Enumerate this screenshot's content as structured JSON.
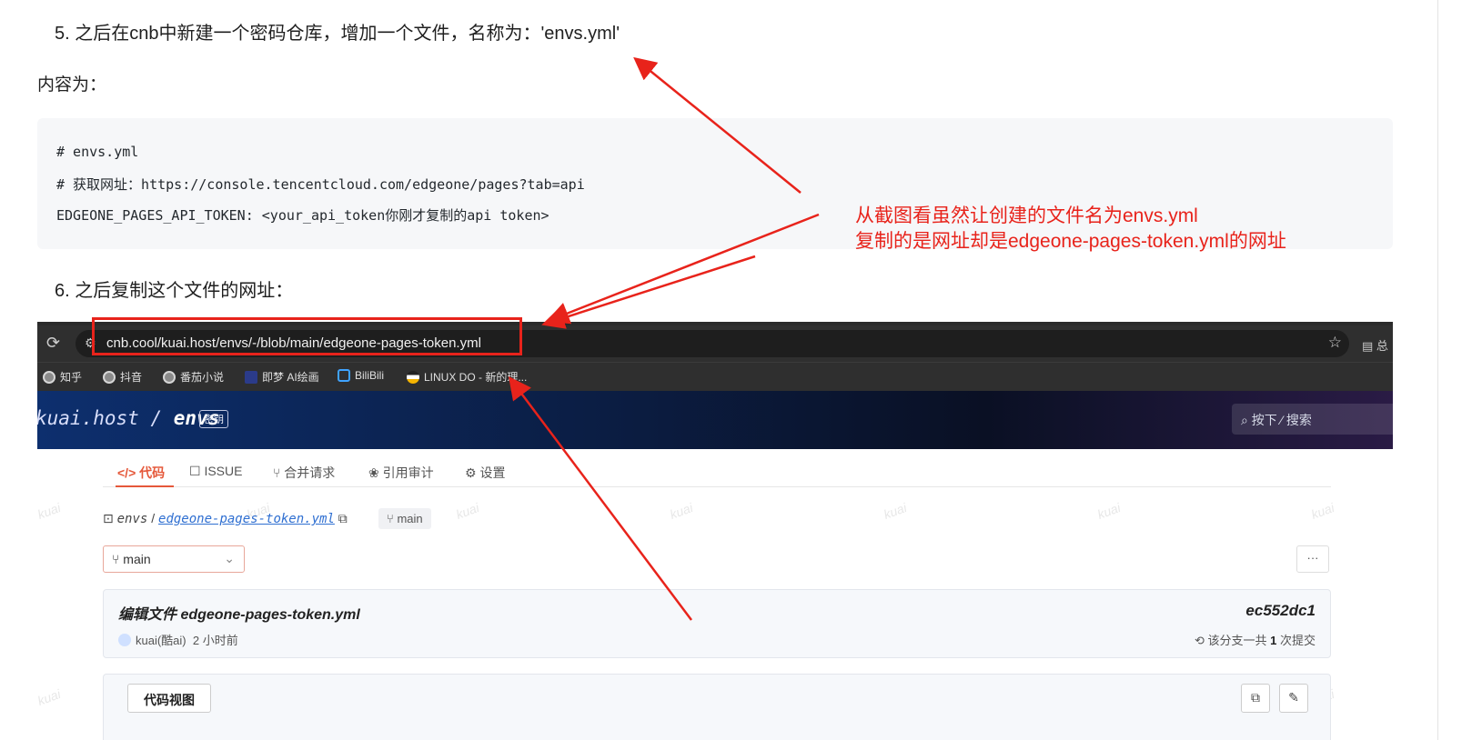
{
  "article": {
    "step5": "5. 之后在cnb中新建一个密码仓库，增加一个文件，名称为：'envs.yml'",
    "content_label": "内容为：",
    "code_lines": [
      "# envs.yml",
      "# 获取网址：https://console.tencentcloud.com/edgeone/pages?tab=api",
      "EDGEONE_PAGES_API_TOKEN: <your_api_token你刚才复制的api token>"
    ],
    "step6": "6. 之后复制这个文件的网址："
  },
  "annotation": {
    "line1": "从截图看虽然让创建的文件名为envs.yml",
    "line2": "复制的是网址却是edgeone-pages-token.yml的网址",
    "color": "#e8231b"
  },
  "browser": {
    "url": "cnb.cool/kuai.host/envs/-/blob/main/edgeone-pages-token.yml",
    "right_fragment": "总",
    "bookmarks": [
      {
        "label": "知乎",
        "icon": "globe-icon"
      },
      {
        "label": "抖音",
        "icon": "globe-icon"
      },
      {
        "label": "番茄小说",
        "icon": "globe-icon"
      },
      {
        "label": "即梦 AI绘画",
        "icon": "star-icon"
      },
      {
        "label": "BiliBili",
        "icon": "tv-icon"
      },
      {
        "label": "LINUX DO - 新的理...",
        "icon": "linuxdo-icon"
      }
    ]
  },
  "repo": {
    "owner": "kuai.host",
    "sep": "/",
    "name": "envs",
    "badge": "密钥",
    "search_placeholder": "按下 ⁄ 搜索",
    "tabs": [
      {
        "label": "代码",
        "icon": "code-icon",
        "active": true
      },
      {
        "label": "ISSUE",
        "icon": "issue-icon"
      },
      {
        "label": "合并请求",
        "icon": "merge-icon"
      },
      {
        "label": "引用审计",
        "icon": "audit-icon"
      },
      {
        "label": "设置",
        "icon": "settings-icon"
      }
    ],
    "breadcrumb_root": "envs",
    "breadcrumb_sep": "/",
    "breadcrumb_file": "edgeone-pages-token.yml",
    "branch_chip": "main",
    "branch_select": "main",
    "more": "···",
    "watermark": "kuai",
    "commit": {
      "title": "编辑文件 edgeone-pages-token.yml",
      "hash": "ec552dc1",
      "author": "kuai(酷ai)",
      "time": "2 小时前",
      "count_prefix": "该分支一共",
      "count": "1",
      "count_suffix": "次提交"
    },
    "code_view_label": "代码视图"
  }
}
